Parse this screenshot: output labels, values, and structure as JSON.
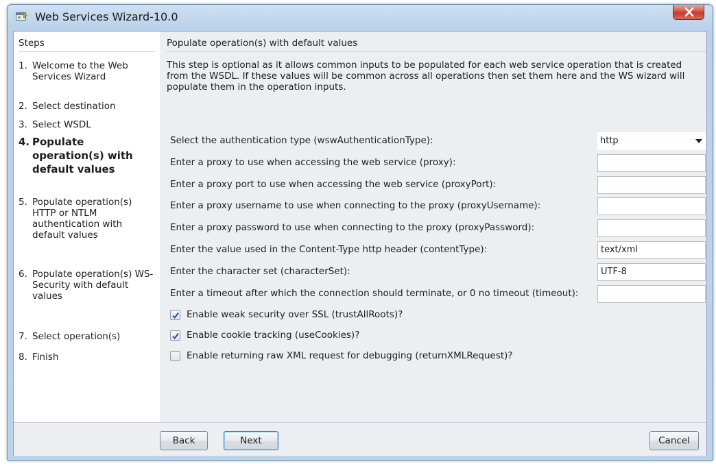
{
  "window": {
    "title": "Web Services Wizard-10.0",
    "icon": "wizard-app-icon",
    "close_icon": "close-x-icon"
  },
  "sidebar": {
    "heading": "Steps",
    "steps": [
      {
        "num": "1.",
        "label": "Welcome to the Web Services Wizard",
        "current": false
      },
      {
        "num": "2.",
        "label": "Select destination",
        "current": false
      },
      {
        "num": "3.",
        "label": "Select WSDL",
        "current": false
      },
      {
        "num": "4.",
        "label": "Populate operation(s) with default values",
        "current": true
      },
      {
        "num": "5.",
        "label": "Populate operation(s) HTTP or NTLM authentication with default values",
        "current": false
      },
      {
        "num": "6.",
        "label": "Populate operation(s) WS-Security with default values",
        "current": false
      },
      {
        "num": "7.",
        "label": "Select operation(s)",
        "current": false
      },
      {
        "num": "8.",
        "label": "Finish",
        "current": false
      }
    ]
  },
  "main": {
    "heading": "Populate operation(s) with default values",
    "description": "This step is optional as it allows common inputs to be populated for each web service operation that is created from the WSDL. If these values will be common across all operations then set them here and the WS wizard will populate them in the operation inputs.",
    "fields": [
      {
        "label": "Select the authentication type (wswAuthenticationType):",
        "value": "http",
        "type": "select"
      },
      {
        "label": "Enter a proxy to use when accessing the web service (proxy):",
        "value": "",
        "type": "text"
      },
      {
        "label": "Enter a proxy port to use when accessing the web service (proxyPort):",
        "value": "",
        "type": "text"
      },
      {
        "label": "Enter a proxy username to use when connecting to the proxy (proxyUsername):",
        "value": "",
        "type": "text"
      },
      {
        "label": "Enter a proxy password to use when connecting to the proxy (proxyPassword):",
        "value": "",
        "type": "text"
      },
      {
        "label": "Enter the value used in the Content-Type http header (contentType):",
        "value": "text/xml",
        "type": "text"
      },
      {
        "label": "Enter the character set (characterSet):",
        "value": "UTF-8",
        "type": "text"
      },
      {
        "label": "Enter a timeout after which the connection should terminate, or 0 no timeout (timeout):",
        "value": "",
        "type": "text"
      }
    ],
    "checkboxes": [
      {
        "label": "Enable weak security over SSL (trustAllRoots)?",
        "checked": true
      },
      {
        "label": "Enable cookie tracking (useCookies)?",
        "checked": true
      },
      {
        "label": "Enable returning raw XML request for debugging (returnXMLRequest)?",
        "checked": false
      }
    ]
  },
  "footer": {
    "back_label": "Back",
    "next_label": "Next",
    "cancel_label": "Cancel"
  },
  "colors": {
    "title_bar": "#b9d1ea",
    "close_button": "#c9463a",
    "panel_background": "#eceef2",
    "sidebar_background": "#ffffff",
    "default_button_border": "#3b7bbf"
  }
}
